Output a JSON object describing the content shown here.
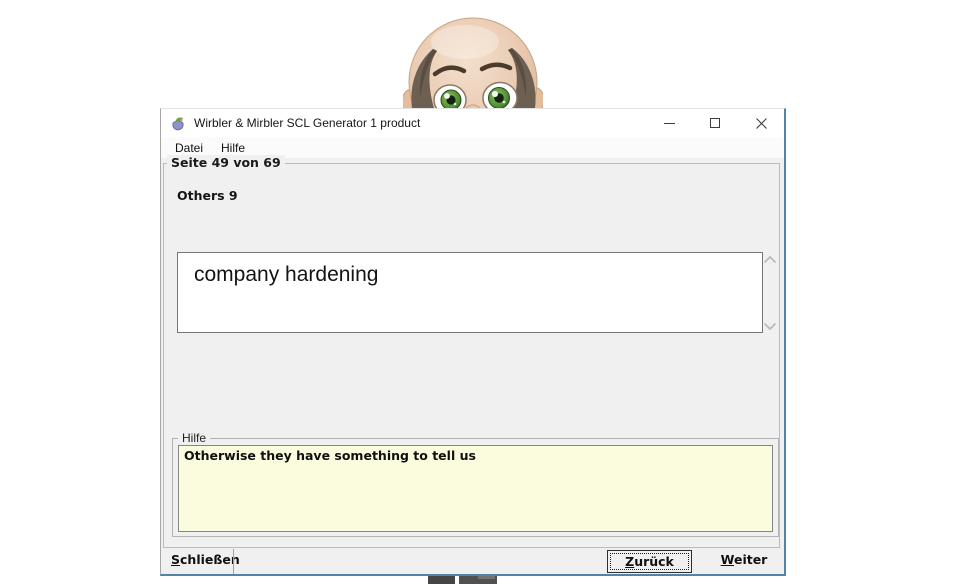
{
  "window": {
    "title": "Wirbler & Mirbler SCL Generator 1 product"
  },
  "menu": {
    "items": [
      {
        "label": "Datei"
      },
      {
        "label": "Hilfe"
      }
    ]
  },
  "page": {
    "group_title": "Seite 49 von 69",
    "question_label": "Others 9",
    "answer_text": "company hardening"
  },
  "help": {
    "group_title": "Hilfe",
    "text": "Otherwise they have something to tell us"
  },
  "footer": {
    "close_label": "Schließen",
    "back_label": "Zurück",
    "next_label": "Weiter"
  },
  "icons": {
    "app": "app-icon",
    "minimize": "minimize-icon",
    "maximize": "maximize-icon",
    "close": "close-icon",
    "scroll_up": "chevron-up-icon",
    "scroll_down": "chevron-down-icon"
  },
  "colors": {
    "window_border_accent": "#4f86a8",
    "control_bg": "#f0f0f0",
    "help_bg": "#fbfbdd",
    "titlebar_bg": "#ffffff"
  }
}
